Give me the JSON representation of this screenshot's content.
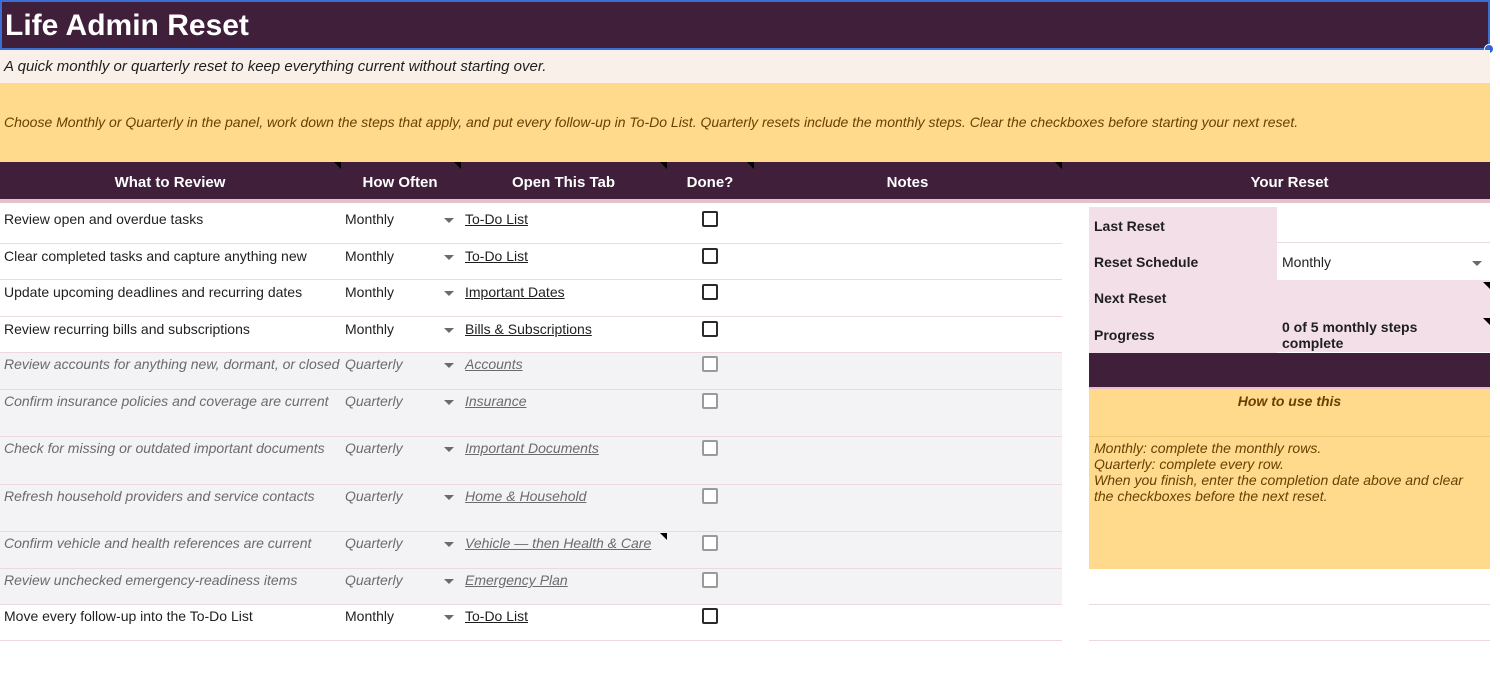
{
  "title": "Life Admin Reset",
  "subtitle": "A quick monthly or quarterly reset to keep everything current without starting over.",
  "instructions": "Choose Monthly or Quarterly in the panel, work down the steps that apply, and put every follow-up in To-Do List. Quarterly resets include the monthly steps. Clear the checkboxes before starting your next reset.",
  "headers": {
    "review": "What to Review",
    "often": "How Often",
    "tab": "Open This Tab",
    "done": "Done?",
    "notes": "Notes",
    "your_reset": "Your Reset"
  },
  "rows": [
    {
      "task": "Review open and overdue tasks",
      "freq": "Monthly",
      "tab": "To-Do List"
    },
    {
      "task": "Clear completed tasks and capture anything new",
      "freq": "Monthly",
      "tab": "To-Do List"
    },
    {
      "task": "Update upcoming deadlines and recurring dates",
      "freq": "Monthly",
      "tab": "Important Dates"
    },
    {
      "task": "Review recurring bills and subscriptions",
      "freq": "Monthly",
      "tab": "Bills & Subscriptions"
    },
    {
      "task": "Review accounts for anything new, dormant, or closed",
      "freq": "Quarterly",
      "tab": "Accounts"
    },
    {
      "task": "Confirm insurance policies and coverage are current",
      "freq": "Quarterly",
      "tab": "Insurance"
    },
    {
      "task": "Check for missing or outdated important documents",
      "freq": "Quarterly",
      "tab": "Important Documents"
    },
    {
      "task": "Refresh household providers and service contacts",
      "freq": "Quarterly",
      "tab": "Home & Household"
    },
    {
      "task": "Confirm vehicle and health references are current",
      "freq": "Quarterly",
      "tab": "Vehicle — then Health & Care"
    },
    {
      "task": "Review unchecked emergency-readiness items",
      "freq": "Quarterly",
      "tab": "Emergency Plan"
    },
    {
      "task": "Move every follow-up into the To-Do List",
      "freq": "Monthly",
      "tab": "To-Do List"
    }
  ],
  "panel": {
    "last_reset_label": "Last Reset",
    "last_reset_value": "",
    "schedule_label": "Reset Schedule",
    "schedule_value": "Monthly",
    "next_reset_label": "Next Reset",
    "next_reset_value": "",
    "progress_label": "Progress",
    "progress_value": "0 of 5 monthly steps complete",
    "howto_title": "How to use this",
    "howto_lines": [
      "Monthly: complete the monthly rows.",
      "Quarterly: complete every row.",
      "When you finish, enter the completion date above and clear the checkboxes before the next reset."
    ]
  },
  "colors": {
    "header_bg": "#3f1f3a",
    "subtitle_bg": "#faf0ea",
    "instructions_bg": "#ffd98c",
    "panel_label_bg": "#f3dfe8",
    "quarterly_row_bg": "#f3f3f5"
  }
}
